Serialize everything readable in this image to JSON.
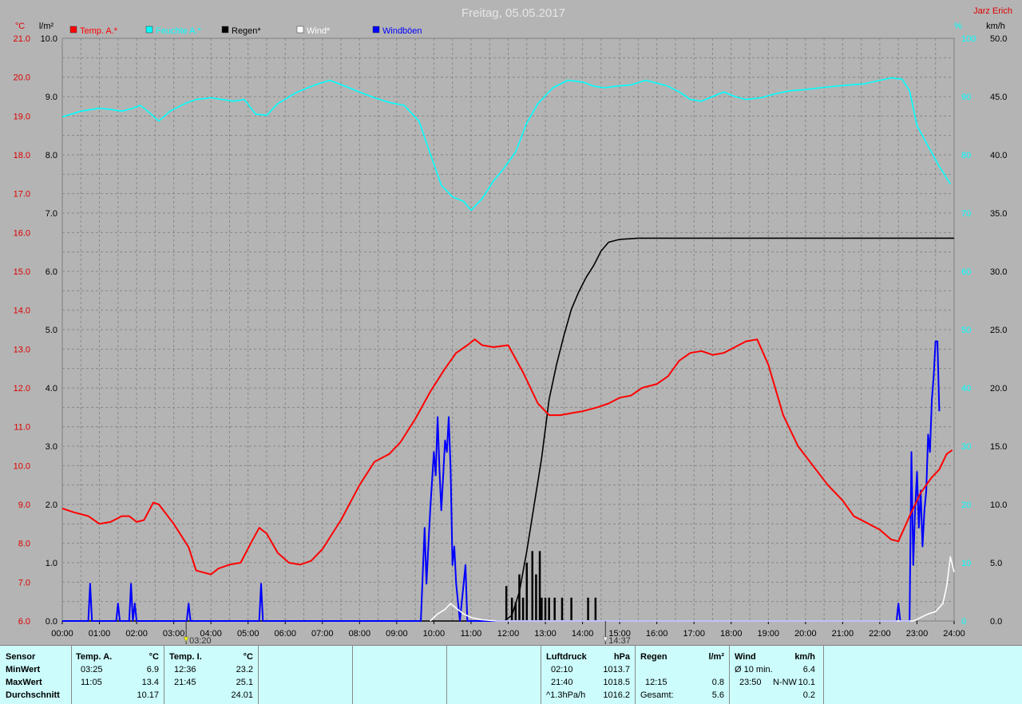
{
  "chart_data": {
    "type": "line",
    "title": "Freitag, 05.05.2017",
    "station": "Jarz Erich",
    "x_ticks": [
      "00:00",
      "01:00",
      "02:00",
      "03:00",
      "04:00",
      "05:00",
      "06:00",
      "07:00",
      "08:00",
      "09:00",
      "10:00",
      "11:00",
      "12:00",
      "13:00",
      "14:00",
      "15:00",
      "16:00",
      "17:00",
      "18:00",
      "19:00",
      "20:00",
      "21:00",
      "22:00",
      "23:00",
      "24:00"
    ],
    "x_markers": [
      "03:20",
      "14:37"
    ],
    "axes": {
      "temp": {
        "label": "°C",
        "ylim": [
          6.0,
          21.0
        ],
        "ticks": [
          "21.0",
          "20.0",
          "19.0",
          "18.0",
          "17.0",
          "16.0",
          "15.0",
          "14.0",
          "13.0",
          "12.0",
          "11.0",
          "10.0",
          "9.0",
          "8.0",
          "7.0",
          "6.0"
        ],
        "color": "#ff0000"
      },
      "rain": {
        "label": "l/m²",
        "ylim": [
          0.0,
          10.0
        ],
        "ticks": [
          "10.0",
          "9.0",
          "8.0",
          "7.0",
          "6.0",
          "5.0",
          "4.0",
          "3.0",
          "2.0",
          "1.0",
          "0.0"
        ],
        "color": "#000000"
      },
      "humidity": {
        "label": "%",
        "ylim": [
          0,
          100
        ],
        "ticks": [
          "100",
          "90",
          "80",
          "70",
          "60",
          "50",
          "40",
          "30",
          "20",
          "10",
          "0"
        ],
        "color": "#00ffff"
      },
      "wind": {
        "label": "km/h",
        "ylim": [
          0.0,
          50.0
        ],
        "ticks": [
          "50.0",
          "45.0",
          "40.0",
          "35.0",
          "30.0",
          "25.0",
          "20.0",
          "15.0",
          "10.0",
          "5.0",
          "0.0"
        ],
        "color": "#000000"
      }
    },
    "grid": true,
    "legend": [
      {
        "name": "Temp. A.*",
        "color": "#ff0000"
      },
      {
        "name": "Feuchte A.*",
        "color": "#00ffff"
      },
      {
        "name": "Regen*",
        "color": "#000000"
      },
      {
        "name": "Wind*",
        "color": "#ffffff"
      },
      {
        "name": "Windböen",
        "color": "#0000ff"
      }
    ],
    "series": [
      {
        "key": "temp",
        "axis": "temp",
        "color": "#ff0000",
        "points": [
          [
            0,
            8.9
          ],
          [
            0.3,
            8.8
          ],
          [
            0.7,
            8.7
          ],
          [
            1.0,
            8.5
          ],
          [
            1.3,
            8.55
          ],
          [
            1.6,
            8.7
          ],
          [
            1.8,
            8.7
          ],
          [
            2.0,
            8.55
          ],
          [
            2.2,
            8.6
          ],
          [
            2.45,
            9.05
          ],
          [
            2.6,
            9.0
          ],
          [
            3.0,
            8.5
          ],
          [
            3.4,
            7.9
          ],
          [
            3.6,
            7.3
          ],
          [
            3.8,
            7.25
          ],
          [
            4.0,
            7.2
          ],
          [
            4.2,
            7.35
          ],
          [
            4.5,
            7.45
          ],
          [
            4.8,
            7.5
          ],
          [
            5.1,
            8.05
          ],
          [
            5.3,
            8.4
          ],
          [
            5.5,
            8.25
          ],
          [
            5.8,
            7.75
          ],
          [
            6.1,
            7.5
          ],
          [
            6.4,
            7.45
          ],
          [
            6.7,
            7.55
          ],
          [
            7.0,
            7.85
          ],
          [
            7.5,
            8.6
          ],
          [
            8.0,
            9.5
          ],
          [
            8.4,
            10.1
          ],
          [
            8.8,
            10.3
          ],
          [
            9.1,
            10.6
          ],
          [
            9.5,
            11.2
          ],
          [
            9.9,
            11.9
          ],
          [
            10.3,
            12.5
          ],
          [
            10.6,
            12.9
          ],
          [
            10.9,
            13.1
          ],
          [
            11.1,
            13.25
          ],
          [
            11.3,
            13.1
          ],
          [
            11.6,
            13.05
          ],
          [
            12.0,
            13.1
          ],
          [
            12.4,
            12.4
          ],
          [
            12.8,
            11.6
          ],
          [
            13.1,
            11.3
          ],
          [
            13.4,
            11.3
          ],
          [
            13.7,
            11.35
          ],
          [
            14.0,
            11.4
          ],
          [
            14.4,
            11.5
          ],
          [
            14.7,
            11.6
          ],
          [
            15.0,
            11.75
          ],
          [
            15.3,
            11.8
          ],
          [
            15.6,
            12.0
          ],
          [
            16.0,
            12.1
          ],
          [
            16.3,
            12.3
          ],
          [
            16.6,
            12.7
          ],
          [
            16.9,
            12.9
          ],
          [
            17.2,
            12.95
          ],
          [
            17.5,
            12.85
          ],
          [
            17.8,
            12.9
          ],
          [
            18.1,
            13.05
          ],
          [
            18.4,
            13.2
          ],
          [
            18.7,
            13.25
          ],
          [
            19.0,
            12.6
          ],
          [
            19.4,
            11.3
          ],
          [
            19.8,
            10.5
          ],
          [
            20.2,
            10.0
          ],
          [
            20.6,
            9.5
          ],
          [
            21.0,
            9.1
          ],
          [
            21.3,
            8.7
          ],
          [
            21.7,
            8.5
          ],
          [
            22.0,
            8.35
          ],
          [
            22.3,
            8.1
          ],
          [
            22.5,
            8.05
          ],
          [
            22.8,
            8.7
          ],
          [
            23.1,
            9.3
          ],
          [
            23.4,
            9.7
          ],
          [
            23.6,
            9.9
          ],
          [
            23.8,
            10.3
          ],
          [
            23.95,
            10.4
          ]
        ]
      },
      {
        "key": "humidity",
        "axis": "humidity",
        "color": "#00ffff",
        "points": [
          [
            0,
            86.5
          ],
          [
            0.5,
            87.5
          ],
          [
            1.0,
            88
          ],
          [
            1.3,
            87.8
          ],
          [
            1.6,
            87.5
          ],
          [
            1.9,
            88
          ],
          [
            2.1,
            88.5
          ],
          [
            2.3,
            87.5
          ],
          [
            2.6,
            85.8
          ],
          [
            2.9,
            87.5
          ],
          [
            3.3,
            88.8
          ],
          [
            3.6,
            89.5
          ],
          [
            4.0,
            89.8
          ],
          [
            4.3,
            89.5
          ],
          [
            4.6,
            89.2
          ],
          [
            4.9,
            89.5
          ],
          [
            5.2,
            87
          ],
          [
            5.5,
            86.8
          ],
          [
            5.8,
            88.8
          ],
          [
            6.3,
            90.7
          ],
          [
            6.8,
            92
          ],
          [
            7.2,
            92.8
          ],
          [
            7.6,
            91.8
          ],
          [
            8.0,
            90.8
          ],
          [
            8.4,
            89.8
          ],
          [
            8.8,
            89.0
          ],
          [
            9.2,
            88.5
          ],
          [
            9.6,
            85.8
          ],
          [
            9.9,
            80.2
          ],
          [
            10.2,
            74.8
          ],
          [
            10.5,
            72.8
          ],
          [
            10.8,
            72.0
          ],
          [
            11.0,
            70.5
          ],
          [
            11.3,
            72.5
          ],
          [
            11.6,
            75.5
          ],
          [
            11.9,
            77.8
          ],
          [
            12.2,
            80.5
          ],
          [
            12.5,
            85.5
          ],
          [
            12.8,
            88.8
          ],
          [
            13.2,
            91.5
          ],
          [
            13.6,
            92.8
          ],
          [
            14.0,
            92.5
          ],
          [
            14.3,
            91.8
          ],
          [
            14.6,
            91.5
          ],
          [
            14.9,
            91.8
          ],
          [
            15.3,
            92.0
          ],
          [
            15.7,
            92.8
          ],
          [
            16.0,
            92.3
          ],
          [
            16.3,
            91.8
          ],
          [
            16.6,
            90.8
          ],
          [
            16.9,
            89.5
          ],
          [
            17.2,
            89.2
          ],
          [
            17.5,
            90.0
          ],
          [
            17.8,
            90.8
          ],
          [
            18.1,
            90.0
          ],
          [
            18.4,
            89.5
          ],
          [
            18.8,
            89.8
          ],
          [
            19.2,
            90.5
          ],
          [
            19.6,
            91.0
          ],
          [
            20.0,
            91.2
          ],
          [
            20.4,
            91.5
          ],
          [
            20.8,
            91.8
          ],
          [
            21.2,
            92.0
          ],
          [
            21.6,
            92.2
          ],
          [
            22.0,
            92.8
          ],
          [
            22.3,
            93.2
          ],
          [
            22.6,
            93.0
          ],
          [
            22.8,
            91.0
          ],
          [
            23.0,
            85.0
          ],
          [
            23.3,
            81.5
          ],
          [
            23.6,
            78.0
          ],
          [
            23.9,
            75.0
          ]
        ]
      },
      {
        "key": "rain",
        "axis": "rain",
        "color": "#000000",
        "points": [
          [
            0,
            0
          ],
          [
            11.9,
            0
          ],
          [
            12.1,
            0.1
          ],
          [
            12.3,
            0.5
          ],
          [
            12.5,
            1.2
          ],
          [
            12.7,
            2.0
          ],
          [
            12.9,
            2.8
          ],
          [
            13.1,
            3.8
          ],
          [
            13.3,
            4.4
          ],
          [
            13.5,
            4.9
          ],
          [
            13.7,
            5.35
          ],
          [
            13.9,
            5.65
          ],
          [
            14.1,
            5.9
          ],
          [
            14.3,
            6.1
          ],
          [
            14.5,
            6.35
          ],
          [
            14.7,
            6.5
          ],
          [
            15.0,
            6.55
          ],
          [
            15.5,
            6.57
          ],
          [
            16.0,
            6.57
          ],
          [
            24,
            6.57
          ]
        ]
      },
      {
        "key": "wind",
        "axis": "wind",
        "color": "#ffffff",
        "points": [
          [
            9.9,
            0
          ],
          [
            10.1,
            0.6
          ],
          [
            10.3,
            1.0
          ],
          [
            10.45,
            1.5
          ],
          [
            10.6,
            1.1
          ],
          [
            10.8,
            0.6
          ],
          [
            11.0,
            0.3
          ],
          [
            11.3,
            0.1
          ],
          [
            11.7,
            0
          ],
          [
            22.9,
            0
          ],
          [
            23.1,
            0.3
          ],
          [
            23.3,
            0.6
          ],
          [
            23.5,
            0.8
          ],
          [
            23.7,
            1.5
          ],
          [
            23.8,
            3.0
          ],
          [
            23.9,
            5.5
          ],
          [
            24,
            4.2
          ]
        ]
      },
      {
        "key": "gusts",
        "axis": "wind",
        "color": "#0000ff",
        "points": [
          [
            0,
            0
          ],
          [
            0.7,
            0
          ],
          [
            0.75,
            3.2
          ],
          [
            0.8,
            0
          ],
          [
            1.45,
            0
          ],
          [
            1.5,
            1.5
          ],
          [
            1.55,
            0
          ],
          [
            1.8,
            0
          ],
          [
            1.85,
            3.2
          ],
          [
            1.9,
            0
          ],
          [
            1.95,
            1.5
          ],
          [
            2.0,
            0
          ],
          [
            3.35,
            0
          ],
          [
            3.4,
            1.5
          ],
          [
            3.45,
            0
          ],
          [
            5.3,
            0
          ],
          [
            5.35,
            3.2
          ],
          [
            5.4,
            0
          ],
          [
            9.65,
            0
          ],
          [
            9.75,
            8.0
          ],
          [
            9.8,
            3.2
          ],
          [
            9.9,
            9.5
          ],
          [
            10.0,
            14.5
          ],
          [
            10.05,
            12.5
          ],
          [
            10.1,
            17.5
          ],
          [
            10.15,
            13.0
          ],
          [
            10.2,
            9.5
          ],
          [
            10.25,
            12.5
          ],
          [
            10.3,
            15.5
          ],
          [
            10.35,
            14.5
          ],
          [
            10.4,
            17.5
          ],
          [
            10.45,
            13.0
          ],
          [
            10.5,
            4.8
          ],
          [
            10.55,
            6.4
          ],
          [
            10.6,
            3.2
          ],
          [
            10.7,
            0
          ],
          [
            10.85,
            4.8
          ],
          [
            10.9,
            0
          ],
          [
            22.45,
            0
          ],
          [
            22.5,
            1.5
          ],
          [
            22.55,
            0
          ],
          [
            22.8,
            0
          ],
          [
            22.85,
            14.5
          ],
          [
            22.9,
            4.8
          ],
          [
            22.95,
            9.5
          ],
          [
            23.0,
            12.8
          ],
          [
            23.05,
            8.0
          ],
          [
            23.1,
            11.2
          ],
          [
            23.15,
            6.4
          ],
          [
            23.2,
            9.5
          ],
          [
            23.25,
            11.2
          ],
          [
            23.3,
            16.0
          ],
          [
            23.35,
            14.5
          ],
          [
            23.4,
            19.0
          ],
          [
            23.45,
            21.0
          ],
          [
            23.5,
            24.0
          ],
          [
            23.55,
            24.0
          ],
          [
            23.6,
            18.0
          ]
        ]
      }
    ],
    "rain_bars": [
      [
        11.95,
        1.5
      ],
      [
        12.1,
        1.0
      ],
      [
        12.2,
        0.8
      ],
      [
        12.3,
        2.0
      ],
      [
        12.4,
        1.0
      ],
      [
        12.5,
        2.5
      ],
      [
        12.65,
        3.0
      ],
      [
        12.75,
        2.0
      ],
      [
        12.85,
        3.0
      ],
      [
        12.9,
        1.0
      ],
      [
        13.0,
        1.0
      ],
      [
        13.1,
        1.0
      ],
      [
        13.25,
        1.0
      ],
      [
        13.45,
        1.0
      ],
      [
        13.7,
        1.0
      ],
      [
        14.15,
        1.0
      ],
      [
        14.35,
        1.0
      ]
    ]
  },
  "stats": {
    "sensor": {
      "header": "Sensor",
      "rows": [
        "MinWert",
        "MaxWert",
        "Durchschnitt"
      ]
    },
    "temp_a": {
      "header": "Temp. A.",
      "unit": "°C",
      "min_time": "03:25",
      "min_val": "6.9",
      "max_time": "11:05",
      "max_val": "13.4",
      "avg": "10.17"
    },
    "temp_i": {
      "header": "Temp. I.",
      "unit": "°C",
      "min_time": "12:36",
      "min_val": "23.2",
      "max_time": "21:45",
      "max_val": "25.1",
      "avg": "24.01"
    },
    "pressure": {
      "header": "Luftdruck",
      "unit": "hPa",
      "min_time": "02:10",
      "min_val": "1013.7",
      "max_time": "21:40",
      "max_val": "1018.5",
      "avg_label": "^1.3hPa/h",
      "avg": "1016.2"
    },
    "rain": {
      "header": "Regen",
      "unit": "l/m²",
      "max_time": "12:15",
      "max_val": "0.8",
      "total_label": "Gesamt:",
      "total": "5.6"
    },
    "wind": {
      "header": "Wind",
      "unit": "km/h",
      "avg_label": "Ø 10 min.",
      "avg": "6.4",
      "max_time": "23:50",
      "max_dir": "N-NW",
      "max_val": "10.1",
      "third": "0.2"
    }
  }
}
